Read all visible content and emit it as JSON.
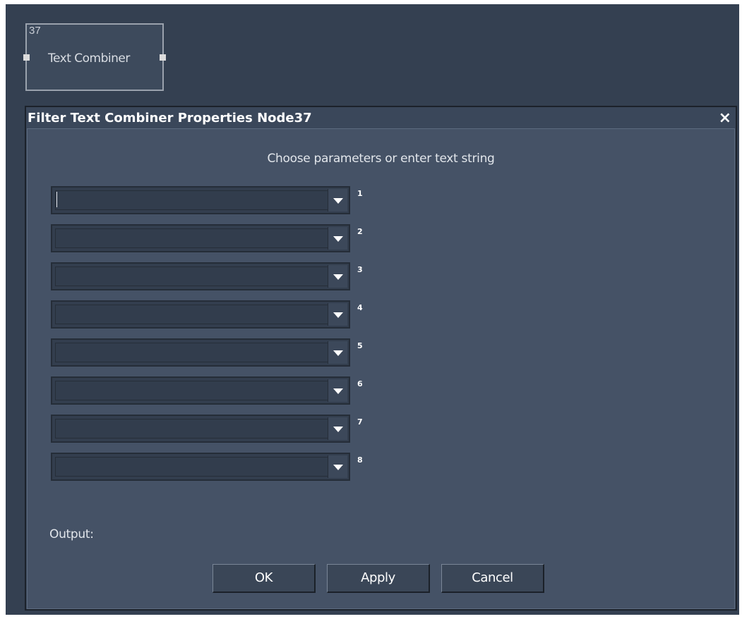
{
  "node": {
    "id": "37",
    "label": "Text Combiner"
  },
  "dialog": {
    "title": "Filter Text Combiner Properties Node37",
    "close_glyph": "×",
    "instruction": "Choose parameters or enter text string",
    "combos": [
      {
        "number": "1",
        "value": ""
      },
      {
        "number": "2",
        "value": ""
      },
      {
        "number": "3",
        "value": ""
      },
      {
        "number": "4",
        "value": ""
      },
      {
        "number": "5",
        "value": ""
      },
      {
        "number": "6",
        "value": ""
      },
      {
        "number": "7",
        "value": ""
      },
      {
        "number": "8",
        "value": ""
      }
    ],
    "output_label": "Output:",
    "buttons": {
      "ok": "OK",
      "apply": "Apply",
      "cancel": "Cancel"
    }
  },
  "colors": {
    "canvas_bg": "#344051",
    "dialog_bg": "#455266",
    "title_text": "#ffffff"
  }
}
